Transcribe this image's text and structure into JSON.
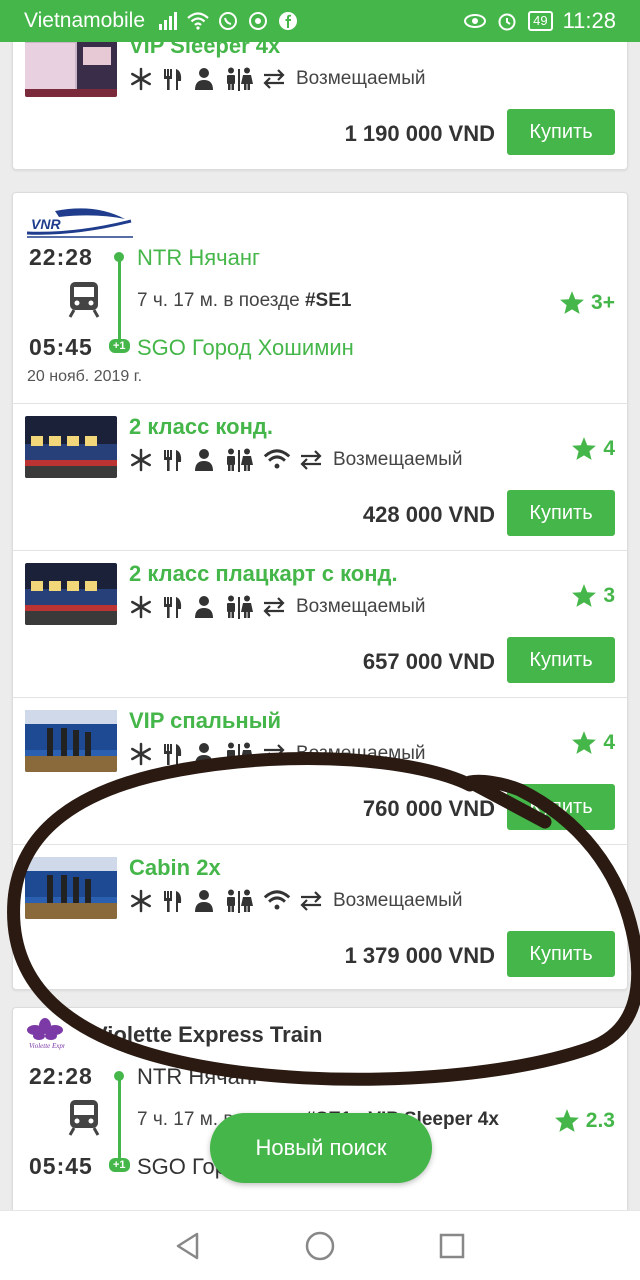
{
  "status_bar": {
    "carrier": "Vietnamobile",
    "battery": "49",
    "time": "11:28"
  },
  "colors": {
    "accent": "#45b649",
    "text": "#333333"
  },
  "top_card": {
    "fare": {
      "name": "VIP Sleeper 4x",
      "refund": "Возмещаемый",
      "price": "1 190 000 VND",
      "buy_label": "Купить"
    }
  },
  "train1": {
    "depart_time": "22:28",
    "depart_station": "NTR Нячанг",
    "duration": "7 ч. 17 м. в поезде",
    "train_no": "#SE1",
    "rating": "3+",
    "arrive_time": "05:45",
    "arrive_badge": "+1",
    "arrive_station": "SGO Город Хошимин",
    "date": "20 нояб. 2019 г.",
    "fares": [
      {
        "name": "2 класс конд.",
        "refund": "Возмещаемый",
        "rating": "4",
        "price": "428 000 VND",
        "buy_label": "Купить"
      },
      {
        "name": "2 класс плацкарт с конд.",
        "refund": "Возмещаемый",
        "rating": "3",
        "price": "657 000 VND",
        "buy_label": "Купить"
      },
      {
        "name": "VIP спальный",
        "refund": "Возмещаемый",
        "rating": "4",
        "price": "760 000 VND",
        "buy_label": "Купить"
      },
      {
        "name": "Cabin 2x",
        "refund": "Возмещаемый",
        "rating": "",
        "price": "1 379 000 VND",
        "buy_label": "Купить"
      }
    ]
  },
  "train2": {
    "operator": "Violette Express Train",
    "depart_time": "22:28",
    "depart_station": "NTR Нячанг",
    "duration": "7 ч. 17 м. в поезде",
    "train_no": "#SE1 · VIP Sleeper 4x",
    "rating": "2.3",
    "arrive_time": "05:45",
    "arrive_badge": "+1",
    "arrive_station": "SGO Город Хошимин"
  },
  "new_search_label": "Новый поиск",
  "icons": [
    "signal-icon",
    "wifi-icon",
    "whatsapp-icon",
    "chrome-icon",
    "facebook-icon",
    "eye-icon",
    "alarm-icon",
    "snowflake-icon",
    "utensils-icon",
    "person-icon",
    "toilet-icon",
    "wifi-icon",
    "exchange-icon",
    "star-icon",
    "train-icon",
    "back-icon",
    "home-icon",
    "recents-icon"
  ]
}
